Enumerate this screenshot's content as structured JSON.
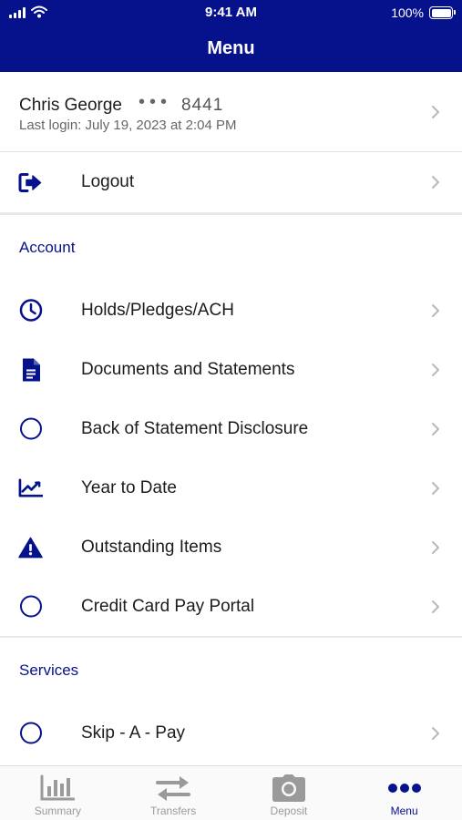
{
  "status_bar": {
    "time": "9:41 AM",
    "battery": "100%",
    "battery_level": 1.0
  },
  "header": {
    "title": "Menu"
  },
  "profile": {
    "name": "Chris George",
    "masked_dots": "•••",
    "account_last4": "8441",
    "last_login": "Last login: July 19, 2023 at 2:04 PM"
  },
  "logout": {
    "label": "Logout",
    "icon": "logout-icon"
  },
  "sections": {
    "account": {
      "title": "Account",
      "items": [
        {
          "label": "Holds/Pledges/ACH",
          "icon": "clock-icon"
        },
        {
          "label": "Documents and Statements",
          "icon": "document-icon"
        },
        {
          "label": "Back of Statement Disclosure",
          "icon": "circle-icon"
        },
        {
          "label": "Year to Date",
          "icon": "trending-chart-icon"
        },
        {
          "label": "Outstanding Items",
          "icon": "warning-icon"
        },
        {
          "label": "Credit Card Pay Portal",
          "icon": "circle-icon"
        }
      ]
    },
    "services": {
      "title": "Services",
      "items": [
        {
          "label": "Skip - A - Pay",
          "icon": "circle-icon"
        }
      ]
    }
  },
  "tab_bar": {
    "tabs": [
      {
        "label": "Summary",
        "icon": "bar-chart-icon",
        "active": false
      },
      {
        "label": "Transfers",
        "icon": "transfer-arrows-icon",
        "active": false
      },
      {
        "label": "Deposit",
        "icon": "camera-icon",
        "active": false
      },
      {
        "label": "Menu",
        "icon": "more-dots-icon",
        "active": true
      }
    ]
  },
  "colors": {
    "brand": "#06128c",
    "inactive_tab": "#9a9a9a",
    "chevron": "#b8b8bd"
  }
}
